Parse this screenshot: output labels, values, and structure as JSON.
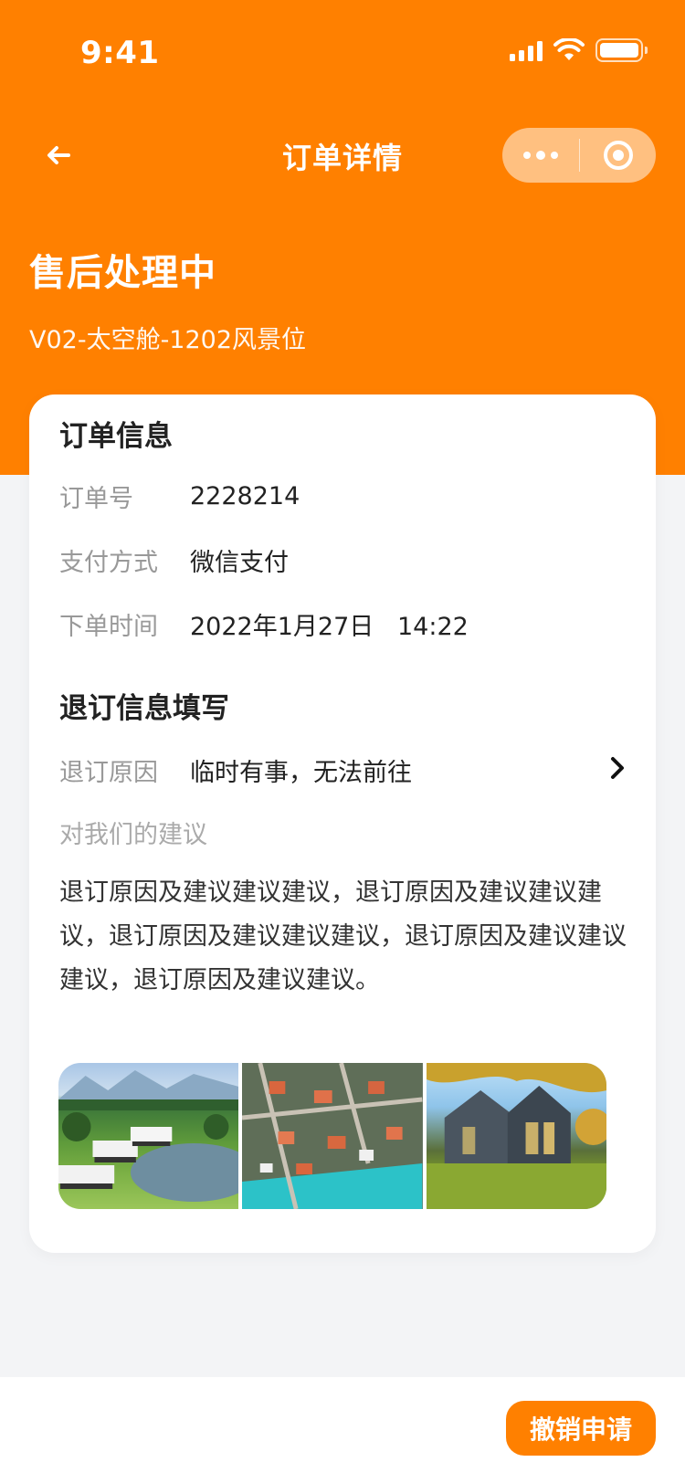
{
  "status_bar": {
    "time": "9:41"
  },
  "nav": {
    "title": "订单详情"
  },
  "order_status": {
    "heading": "售后处理中",
    "room": "V02-太空舱-1202风景位"
  },
  "order_info": {
    "title": "订单信息",
    "rows": [
      {
        "label": "订单号",
        "value": "2228214"
      },
      {
        "label": "支付方式",
        "value": "微信支付"
      },
      {
        "label": "下单时间",
        "value": "2022年1月27日   14:22"
      }
    ]
  },
  "refund_info": {
    "title": "退订信息填写",
    "reason_label": "退订原因",
    "reason_value": "临时有事，无法前往",
    "suggest_label": "对我们的建议",
    "suggest_text": "退订原因及建议建议建议，退订原因及建议建议建议，退订原因及建议建议建议，退订原因及建议建议建议，退订原因及建议建议。"
  },
  "footer": {
    "cancel_label": "撤销申请"
  },
  "colors": {
    "brand": "#ff8000",
    "background": "#f3f4f6"
  }
}
